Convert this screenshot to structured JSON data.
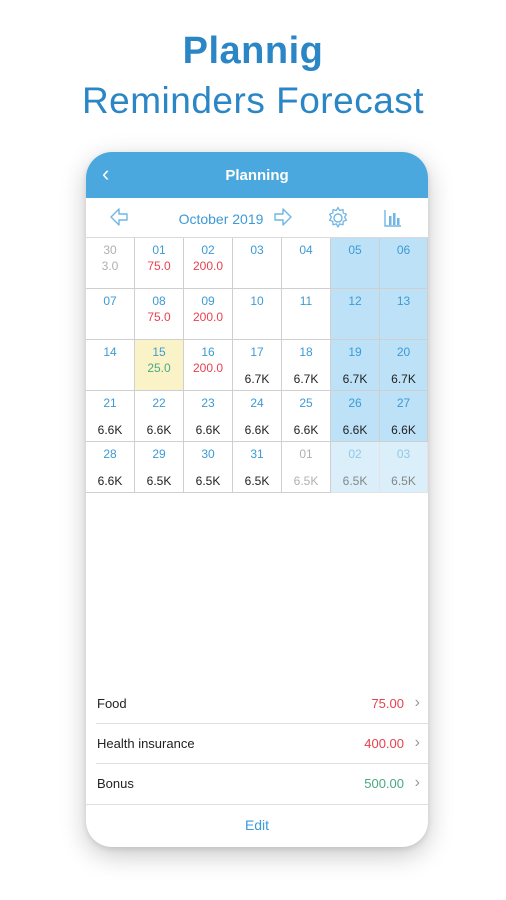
{
  "headline": {
    "line1": "Plannig",
    "line2": "Reminders Forecast"
  },
  "nav": {
    "back_icon": "‹",
    "title": "Planning"
  },
  "monthbar": {
    "month": "October 2019",
    "prev_icon": "left-arrow-icon",
    "next_icon": "right-arrow-icon",
    "settings_icon": "gear-icon",
    "chart_icon": "bar-chart-icon"
  },
  "calendar": {
    "rows": [
      [
        {
          "day": "30",
          "amount": "3.0",
          "amount_color": "gray",
          "day_gray": true
        },
        {
          "day": "01",
          "amount": "75.0",
          "amount_color": "red"
        },
        {
          "day": "02",
          "amount": "200.0",
          "amount_color": "red"
        },
        {
          "day": "03"
        },
        {
          "day": "04"
        },
        {
          "day": "05",
          "weekend": true
        },
        {
          "day": "06",
          "weekend": true
        }
      ],
      [
        {
          "day": "07"
        },
        {
          "day": "08",
          "amount": "75.0",
          "amount_color": "red"
        },
        {
          "day": "09",
          "amount": "200.0",
          "amount_color": "red"
        },
        {
          "day": "10"
        },
        {
          "day": "11"
        },
        {
          "day": "12",
          "weekend": true
        },
        {
          "day": "13",
          "weekend": true
        }
      ],
      [
        {
          "day": "14"
        },
        {
          "day": "15",
          "amount": "25.0",
          "amount_color": "green",
          "today": true
        },
        {
          "day": "16",
          "amount": "200.0",
          "amount_color": "red"
        },
        {
          "day": "17",
          "balance": "6.7K"
        },
        {
          "day": "18",
          "balance": "6.7K"
        },
        {
          "day": "19",
          "balance": "6.7K",
          "weekend": true
        },
        {
          "day": "20",
          "balance": "6.7K",
          "weekend": true
        }
      ],
      [
        {
          "day": "21",
          "balance": "6.6K"
        },
        {
          "day": "22",
          "balance": "6.6K"
        },
        {
          "day": "23",
          "balance": "6.6K"
        },
        {
          "day": "24",
          "balance": "6.6K"
        },
        {
          "day": "25",
          "balance": "6.6K"
        },
        {
          "day": "26",
          "balance": "6.6K",
          "weekend": true
        },
        {
          "day": "27",
          "balance": "6.6K",
          "weekend": true
        }
      ],
      [
        {
          "day": "28",
          "balance": "6.6K"
        },
        {
          "day": "29",
          "balance": "6.5K"
        },
        {
          "day": "30",
          "balance": "6.5K"
        },
        {
          "day": "31",
          "balance": "6.5K"
        },
        {
          "day": "01",
          "balance": "6.5K",
          "day_gray": true,
          "balance_gray": true
        },
        {
          "day": "02",
          "balance": "6.5K",
          "weekend": true,
          "dim": true
        },
        {
          "day": "03",
          "balance": "6.5K",
          "weekend": true,
          "dim": true
        }
      ]
    ]
  },
  "items": [
    {
      "name": "Food",
      "value": "75.00",
      "color": "#e8414f"
    },
    {
      "name": "Health insurance",
      "value": "400.00",
      "color": "#e8414f"
    },
    {
      "name": "Bonus",
      "value": "500.00",
      "color": "#4aa882"
    }
  ],
  "footer": {
    "edit": "Edit"
  },
  "colors": {
    "accent": "#4aa8de",
    "headline": "#2b86c5",
    "weekend": "#bde2f7",
    "today": "#fbf3c8",
    "expense": "#e8414f",
    "income": "#4aa882"
  }
}
